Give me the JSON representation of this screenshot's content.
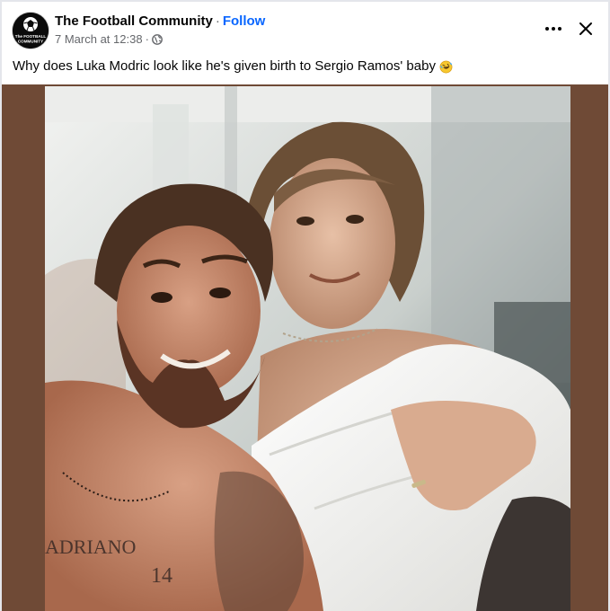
{
  "post": {
    "page_name": "The Football Community",
    "separator": "·",
    "follow_label": "Follow",
    "timestamp": "7 March at 12:38",
    "meta_separator": "·",
    "privacy_icon": "globe-icon",
    "more_icon": "more-horizontal-icon",
    "close_icon": "close-icon",
    "caption": "Why does Luka Modric look like he's given birth to Sergio Ramos' baby",
    "caption_emoji": "rolling-on-floor-laughing-emoji",
    "avatar_text": [
      "The FOOTBALL",
      "COMMUNITY"
    ]
  },
  "colors": {
    "follow": "#0866ff",
    "muted": "#65676b",
    "frame": "#6f4a36"
  }
}
